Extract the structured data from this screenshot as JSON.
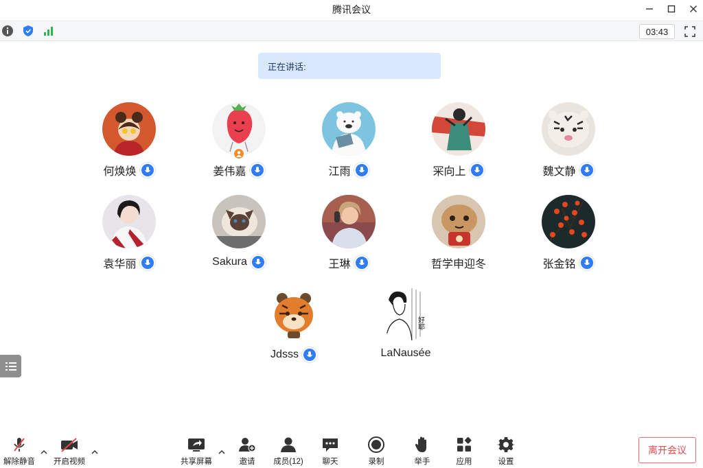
{
  "window": {
    "title": "腾讯会议"
  },
  "infobar": {
    "timer": "03:43"
  },
  "speaking": {
    "label": "正在讲话:"
  },
  "participants": [
    {
      "name": "何焕焕",
      "mic": true
    },
    {
      "name": "姜伟嘉",
      "mic": true,
      "host": true
    },
    {
      "name": "江雨",
      "mic": true
    },
    {
      "name": "冞向上",
      "mic": true
    },
    {
      "name": "魏文静",
      "mic": true
    },
    {
      "name": "袁华丽",
      "mic": true
    },
    {
      "name": "Sakura",
      "mic": true
    },
    {
      "name": "王琳",
      "mic": true
    },
    {
      "name": "哲学申迎冬",
      "mic": false
    },
    {
      "name": "张金铭",
      "mic": true
    },
    {
      "name": "Jdsss",
      "mic": true
    },
    {
      "name": "LaNausée",
      "mic": false
    }
  ],
  "avatar_text": {
    "lanausee": "好耶"
  },
  "toolbar": {
    "unmute": "解除静音",
    "start_video": "开启视频",
    "share_screen": "共享屏幕",
    "invite": "邀请",
    "members": "成员(12)",
    "chat": "聊天",
    "record": "录制",
    "raise_hand": "举手",
    "apps": "应用",
    "settings": "设置",
    "leave": "离开会议"
  },
  "colors": {
    "accent": "#2f7cf6",
    "leave": "#e84a4a",
    "speaking_bg": "#d9e8fd",
    "host_badge": "#f58a2b"
  }
}
